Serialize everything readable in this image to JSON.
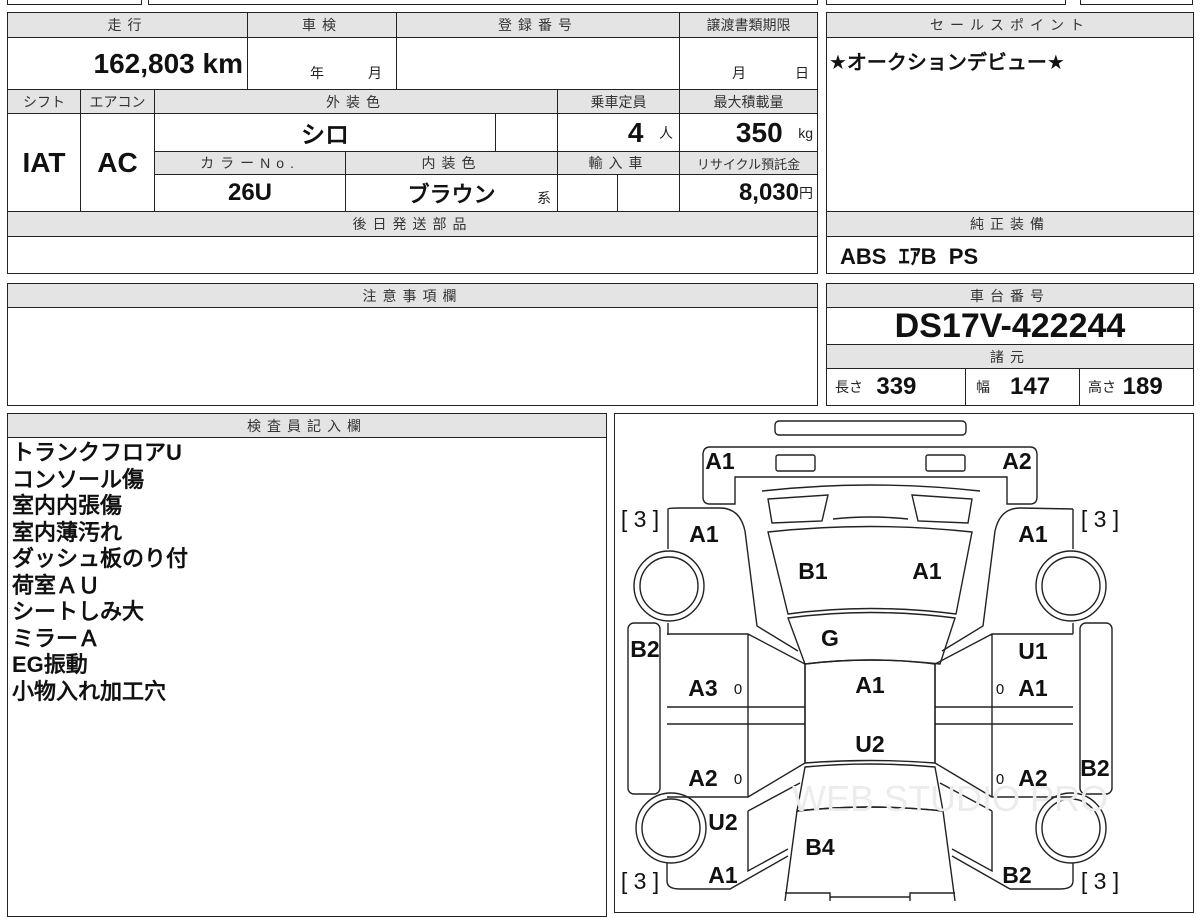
{
  "main_table": {
    "mileage_label": "走行",
    "mileage_value": "162,803",
    "mileage_unit": "km",
    "shaken_label": "車検",
    "shaken_year": "年",
    "shaken_month": "月",
    "registration_label": "登録番号",
    "registration_value": "",
    "transfer_deadline_label": "譲渡書類期限",
    "transfer_month": "月",
    "transfer_day": "日",
    "shift_label": "シフト",
    "shift_value": "IAT",
    "aircon_label": "エアコン",
    "aircon_value": "AC",
    "exterior_color_label": "外装色",
    "exterior_color_value": "シロ",
    "capacity_label": "乗車定員",
    "capacity_value": "4",
    "capacity_unit": "人",
    "max_load_label": "最大積載量",
    "max_load_value": "350",
    "max_load_unit": "kg",
    "color_no_label": "カラーNo.",
    "color_no_value": "26U",
    "interior_color_label": "内装色",
    "interior_color_value": "ブラウン",
    "interior_color_suffix": "系",
    "import_label": "輸入車",
    "recycle_label": "リサイクル預託金",
    "recycle_value": "8,030",
    "recycle_unit": "円",
    "later_parts_label": "後日発送部品"
  },
  "sales_point": {
    "label": "セールスポイント",
    "value": "★オークションデビュー★"
  },
  "equipment": {
    "label": "純正装備",
    "value": "ABS  ｴｱB  PS"
  },
  "caution": {
    "label": "注意事項欄"
  },
  "chassis": {
    "label": "車台番号",
    "value": "DS17V-422244"
  },
  "specs": {
    "label": "諸元",
    "length_label": "長さ",
    "length_value": "339",
    "width_label": "幅",
    "width_value": "147",
    "height_label": "高さ",
    "height_value": "189"
  },
  "inspector": {
    "label": "検査員記入欄",
    "notes": [
      "トランクフロアU",
      "コンソール傷",
      "室内内張傷",
      "室内薄汚れ",
      "ダッシュ板のり付",
      "荷室ＡＵ",
      "シートしみ大",
      "ミラーＡ",
      "EG振動",
      "小物入れ加工穴"
    ]
  },
  "diagram": {
    "watermark": "WEB STUDIO PRO",
    "marks": [
      "A1",
      "A2",
      "[ 3 ]",
      "A1",
      "[ 3 ]",
      "A1",
      "B1",
      "A1",
      "G",
      "B2",
      "U1",
      "A3",
      "0",
      "A1",
      "0",
      "A1",
      "U2",
      "A2",
      "0",
      "0",
      "A2",
      "B2",
      "U2",
      "B4",
      "A1",
      "B2",
      "[ 3 ]",
      "[ 3 ]"
    ]
  }
}
